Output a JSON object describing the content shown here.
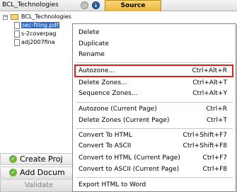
{
  "header": {
    "project_title": "BCL_Technologies",
    "download_glyph": "↓"
  },
  "tabs": [
    {
      "label": "Source",
      "active": true
    }
  ],
  "tree": {
    "root": {
      "label": "BCL_Technologies",
      "expander": "−"
    },
    "files": [
      {
        "label": "sec-filing.pdf",
        "selected": true
      },
      {
        "label": "s-2coverpag"
      },
      {
        "label": "adj2007fina"
      }
    ]
  },
  "left_panel": {
    "create_project": "Create Proj",
    "add_document": "Add Docum",
    "validate": "Validate",
    "check_glyph": "✓"
  },
  "context_menu": {
    "items": [
      {
        "label": "Delete",
        "shortcut": ""
      },
      {
        "label": "Duplicate",
        "shortcut": ""
      },
      {
        "label": "Rename",
        "shortcut": ""
      },
      {
        "label": "Autozone...",
        "shortcut": "Ctrl+Alt+R",
        "highlighted": true
      },
      {
        "label": "Delete Zones...",
        "shortcut": "Ctrl+Alt+T"
      },
      {
        "label": "Sequence Zones...",
        "shortcut": "Ctrl+Alt+Y"
      },
      {
        "label": "Autozone (Current Page)",
        "shortcut": "Ctrl+R"
      },
      {
        "label": "Delete Zones (Current Page)",
        "shortcut": "Ctrl+T"
      },
      {
        "label": "Convert To HTML",
        "shortcut": "Ctrl+Shift+F7"
      },
      {
        "label": "Convert To ASCII",
        "shortcut": "Ctrl+Shift+F8"
      },
      {
        "label": "Convert to HTML (Current Page)",
        "shortcut": "Ctrl+F7"
      },
      {
        "label": "Convert to ASCII (Current Page)",
        "shortcut": "Ctrl+F8"
      },
      {
        "label": "Export HTML to Word",
        "shortcut": ""
      }
    ]
  },
  "colors": {
    "highlight_border": "#e02020",
    "selection": "#316ac5",
    "tab": "#eab53c",
    "check": "#6db53a"
  }
}
